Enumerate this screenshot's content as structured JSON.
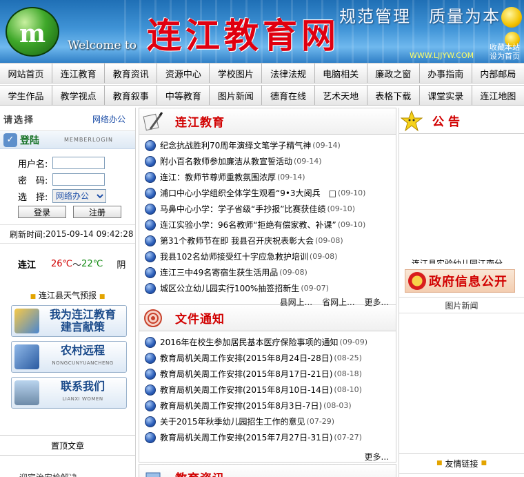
{
  "banner": {
    "welcome": "Welcome to",
    "title": "连江教育网",
    "slogan": "规范管理　质量为本",
    "url": "WWW.LJJYW.COM",
    "link_favorite": "收藏本站",
    "link_homepage": "设为首页"
  },
  "nav_row1": [
    "网站首页",
    "连江教育",
    "教育资讯",
    "资源中心",
    "学校图片",
    "法律法规",
    "电脑相关",
    "廉政之窗",
    "办事指南",
    "内部邮局"
  ],
  "nav_row2": [
    "学生作品",
    "教学视点",
    "教育叙事",
    "中等教育",
    "图片新闻",
    "德育在线",
    "艺术天地",
    "表格下载",
    "课堂实录",
    "连江地图"
  ],
  "left": {
    "choose_label": "请选择",
    "net_office": "网络办公",
    "login_title": "登陆",
    "login_sub": "MEMBERLOGIN",
    "username_label": "用户名:",
    "password_label": "密　码:",
    "select_label": "选　择:",
    "select_value": "网络办公",
    "login_button": "登录",
    "register_button": "注册",
    "refresh_label": "刷新时间:",
    "refresh_time": "2015-09-14 09:42:28",
    "weather": {
      "city": "连江",
      "high": "26℃",
      "sep": "～",
      "low": "22℃",
      "condition": "阴"
    },
    "forecast": "连江县天气预报",
    "side_buttons": [
      {
        "line1": "我为连江教育",
        "line2": "建言献策",
        "sub": ""
      },
      {
        "line1": "农村远程",
        "line2": "",
        "sub": "NONGCUNYUANCHENG"
      },
      {
        "line1": "联系我们",
        "line2": "",
        "sub": "LIANXI WOMEN"
      }
    ],
    "pinned": "置顶文章",
    "cut_text": "迎宾治安检解决"
  },
  "education": {
    "title": "连江教育",
    "items": [
      {
        "text": "纪念抗战胜利70周年演绎文笔学子精气神",
        "date": "(09-14)"
      },
      {
        "text": "附小百名教师参加廉洁从教宣誓活动",
        "date": "(09-14)"
      },
      {
        "text": "连江：教师节尊师重教氛围浓厚",
        "date": "(09-14)"
      },
      {
        "text": "浦口中心小学组织全体学生观看“9•3大阅兵　□",
        "date": "(09-10)"
      },
      {
        "text": "马鼻中心小学：学子省级“手抄报”比赛获佳绩",
        "date": "(09-10)"
      },
      {
        "text": "连江实验小学：96名教师“拒绝有偿家教、补课”",
        "date": "(09-10)"
      },
      {
        "text": "第31个教师节在即 我县召开庆祝表彰大会",
        "date": "(09-08)"
      },
      {
        "text": "我县102名幼师接受红十字应急救护培训",
        "date": "(09-08)"
      },
      {
        "text": "连江三中49名寄宿生获生活用品",
        "date": "(09-08)"
      },
      {
        "text": "城区公立幼儿园实行100%抽签招新生",
        "date": "(09-07)"
      }
    ],
    "more_county": "县网上...",
    "more_province": "省网上...",
    "more": "更多..."
  },
  "notices": {
    "title": "文件通知",
    "items": [
      {
        "text": "2016年在校生参加居民基本医疗保险事项的通知",
        "date": "(09-09)"
      },
      {
        "text": "教育局机关周工作安排(2015年8月24日-28日)",
        "date": "(08-25)"
      },
      {
        "text": "教育局机关周工作安排(2015年8月17日-21日)",
        "date": "(08-18)"
      },
      {
        "text": "教育局机关周工作安排(2015年8月10日-14日)",
        "date": "(08-10)"
      },
      {
        "text": "教育局机关周工作安排(2015年8月3日-7日)",
        "date": "(08-03)"
      },
      {
        "text": "关于2015年秋季幼儿园招生工作的意见",
        "date": "(07-29)"
      },
      {
        "text": "教育局机关周工作安排(2015年7月27日-31日)",
        "date": "(07-27)"
      }
    ],
    "more": "更多..."
  },
  "news_next": {
    "title": "教育资讯"
  },
  "right": {
    "notice_title": "公告",
    "notice_scroll": "连江县实验幼儿园江南分",
    "gov_info": "政府信息公开",
    "pic_news": "图片新闻",
    "friend_links": "友情链接"
  },
  "colors": {
    "accent_red": "#d10000",
    "link_blue": "#1e4fa8"
  }
}
